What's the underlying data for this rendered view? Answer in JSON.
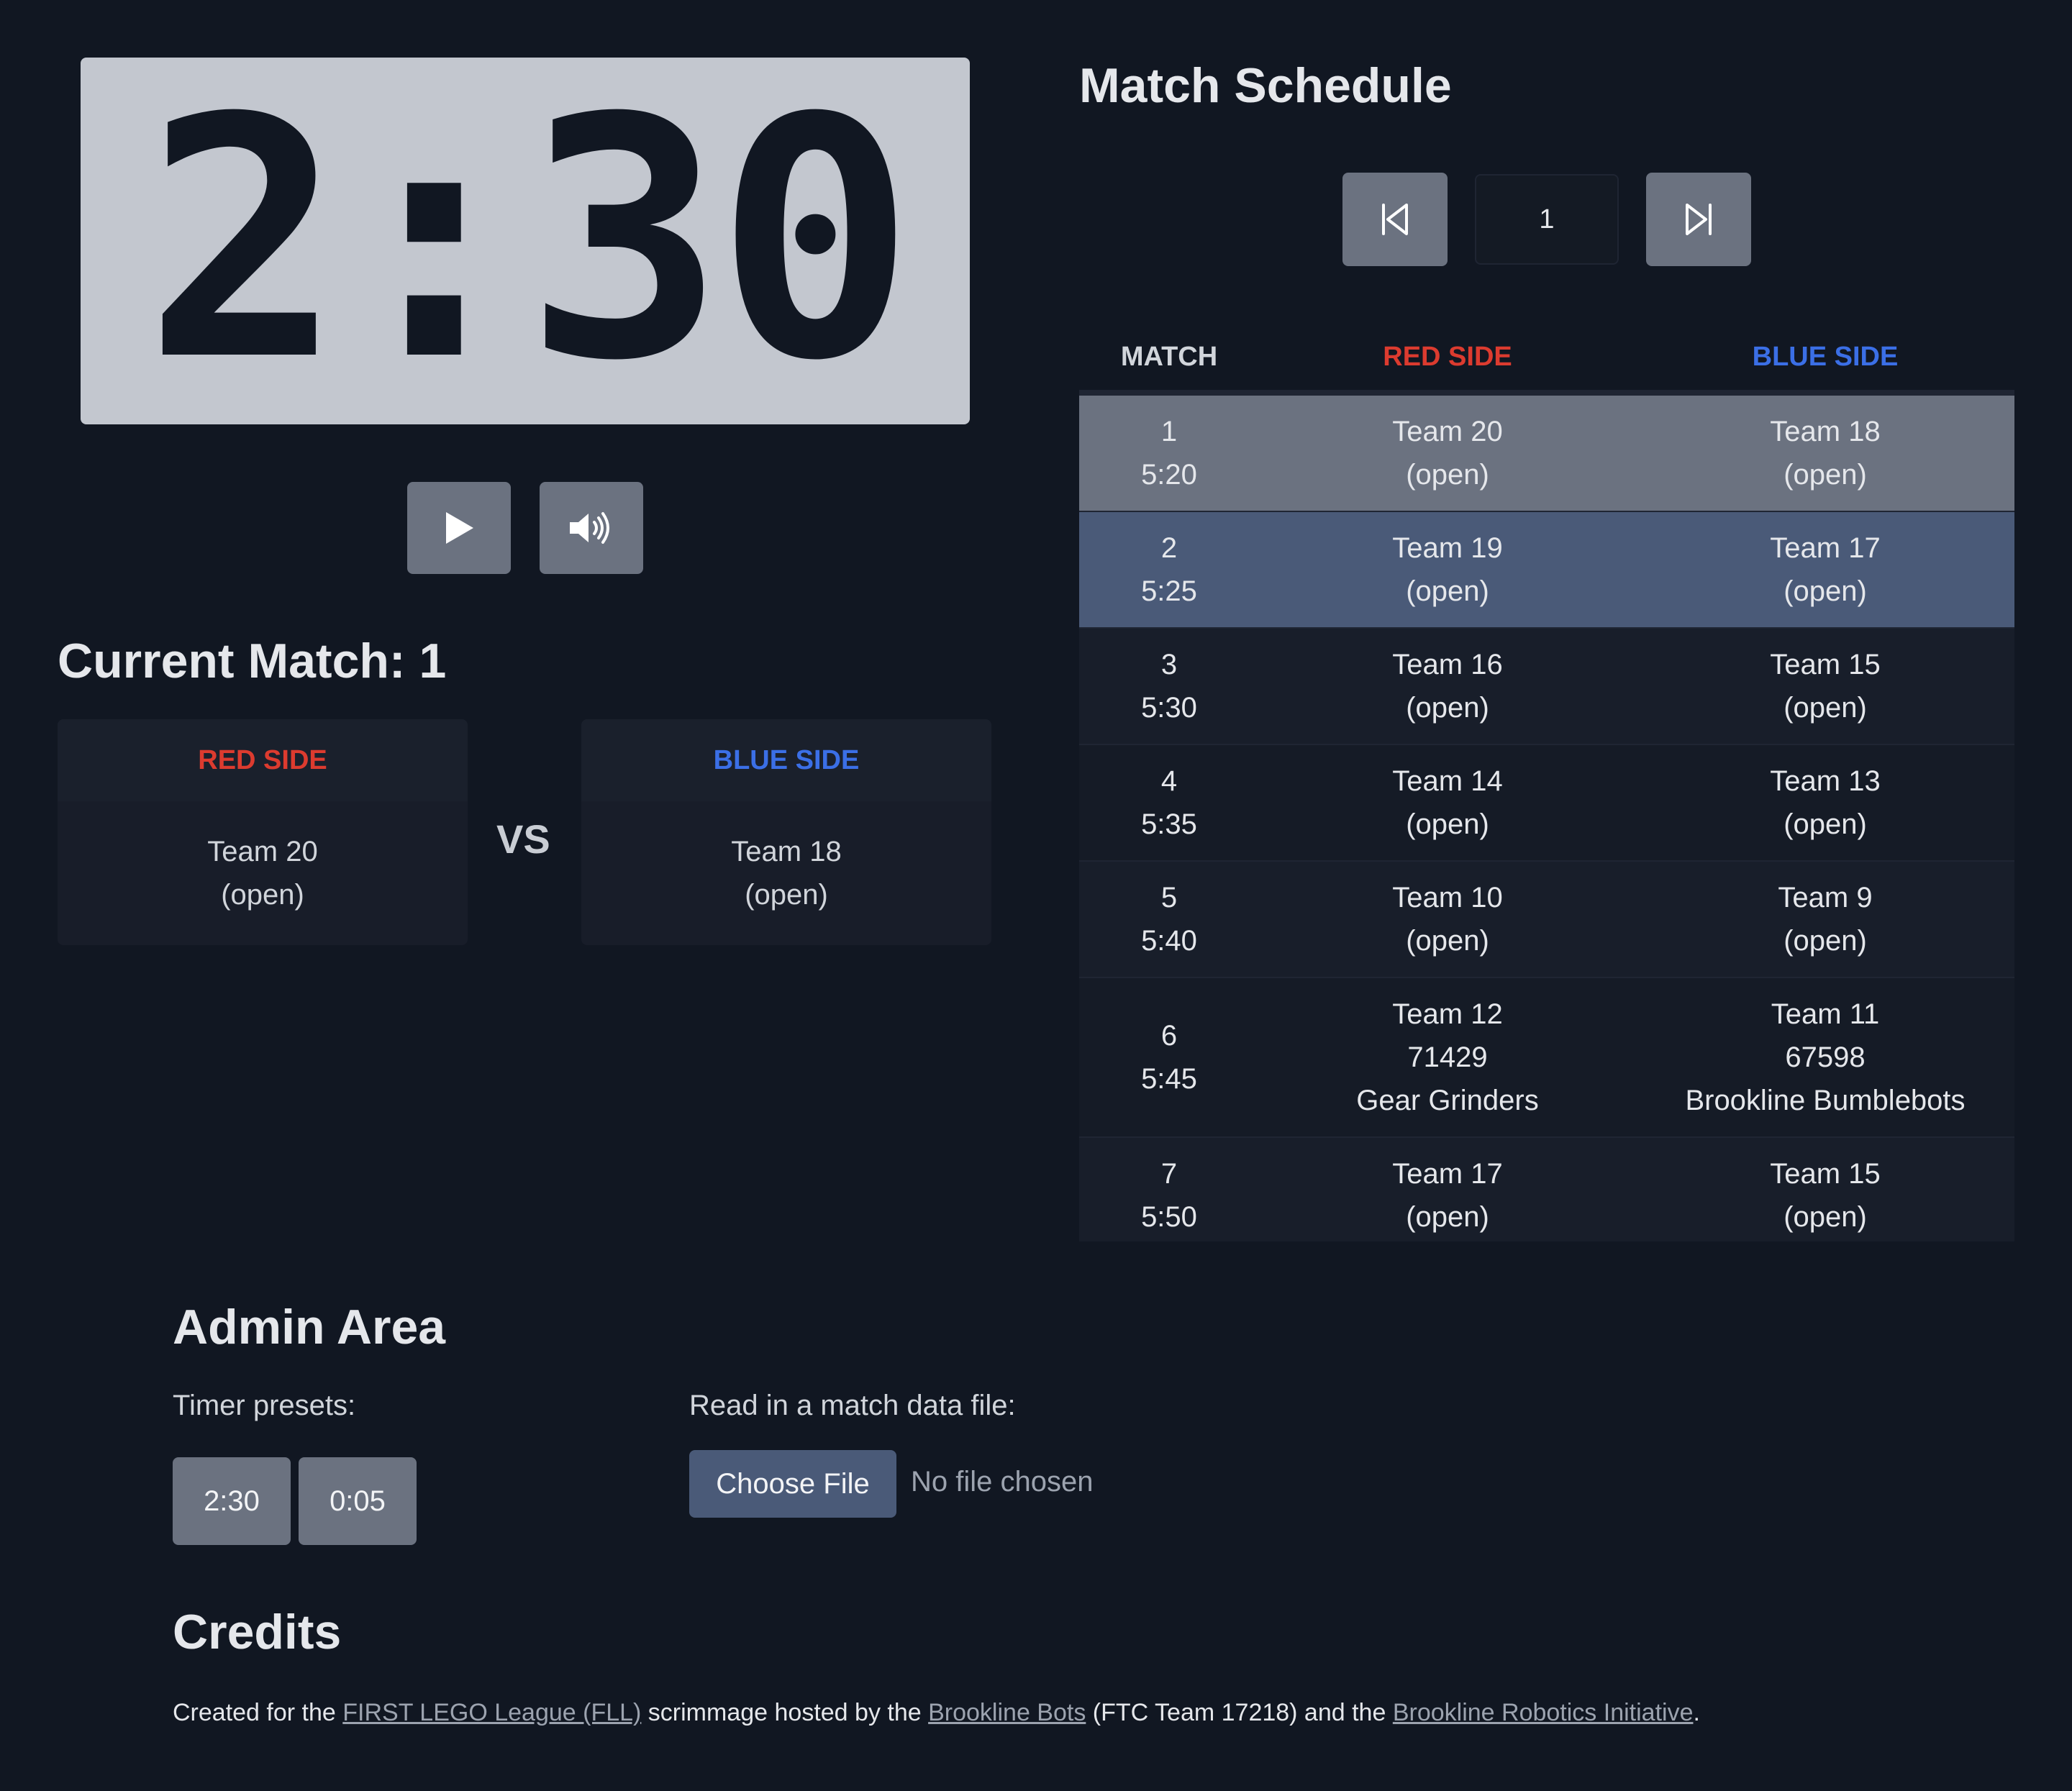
{
  "timer": {
    "display": "2:30"
  },
  "controls": {
    "play_icon": "play-icon",
    "sound_icon": "volume-icon"
  },
  "current_match": {
    "title": "Current Match: 1",
    "red": {
      "label": "RED SIDE",
      "line1": "Team 20",
      "line2": "(open)"
    },
    "vs": "VS",
    "blue": {
      "label": "BLUE SIDE",
      "line1": "Team 18",
      "line2": "(open)"
    }
  },
  "schedule": {
    "title": "Match Schedule",
    "page_value": "1",
    "prev_icon": "skip-back-icon",
    "next_icon": "skip-forward-icon",
    "headers": {
      "match": "MATCH",
      "red": "RED SIDE",
      "blue": "BLUE SIDE"
    },
    "rows": [
      {
        "num": "1",
        "time": "5:20",
        "red": [
          "Team 20",
          "(open)"
        ],
        "blue": [
          "Team 18",
          "(open)"
        ]
      },
      {
        "num": "2",
        "time": "5:25",
        "red": [
          "Team 19",
          "(open)"
        ],
        "blue": [
          "Team 17",
          "(open)"
        ]
      },
      {
        "num": "3",
        "time": "5:30",
        "red": [
          "Team 16",
          "(open)"
        ],
        "blue": [
          "Team 15",
          "(open)"
        ]
      },
      {
        "num": "4",
        "time": "5:35",
        "red": [
          "Team 14",
          "(open)"
        ],
        "blue": [
          "Team 13",
          "(open)"
        ]
      },
      {
        "num": "5",
        "time": "5:40",
        "red": [
          "Team 10",
          "(open)"
        ],
        "blue": [
          "Team 9",
          "(open)"
        ]
      },
      {
        "num": "6",
        "time": "5:45",
        "red": [
          "Team 12",
          "71429",
          "Gear Grinders"
        ],
        "blue": [
          "Team 11",
          "67598",
          "Brookline Bumblebots"
        ]
      },
      {
        "num": "7",
        "time": "5:50",
        "red": [
          "Team 17",
          "(open)"
        ],
        "blue": [
          "Team 15",
          "(open)"
        ]
      }
    ]
  },
  "admin": {
    "title": "Admin Area",
    "presets_label": "Timer presets:",
    "presets": [
      "2:30",
      "0:05"
    ],
    "file_label": "Read in a match data file:",
    "file_button": "Choose File",
    "file_status": "No file chosen"
  },
  "credits": {
    "title": "Credits",
    "t1": "Created for the ",
    "link1": "FIRST LEGO League (FLL)",
    "t2": " scrimmage hosted by the ",
    "link2": "Brookline Bots",
    "t3": " (FTC Team 17218) and the ",
    "link3": "Brookline Robotics Initiative",
    "t4": "."
  },
  "colors": {
    "red": "#dc3b2f",
    "blue": "#3b6fe6",
    "background": "#111722"
  }
}
